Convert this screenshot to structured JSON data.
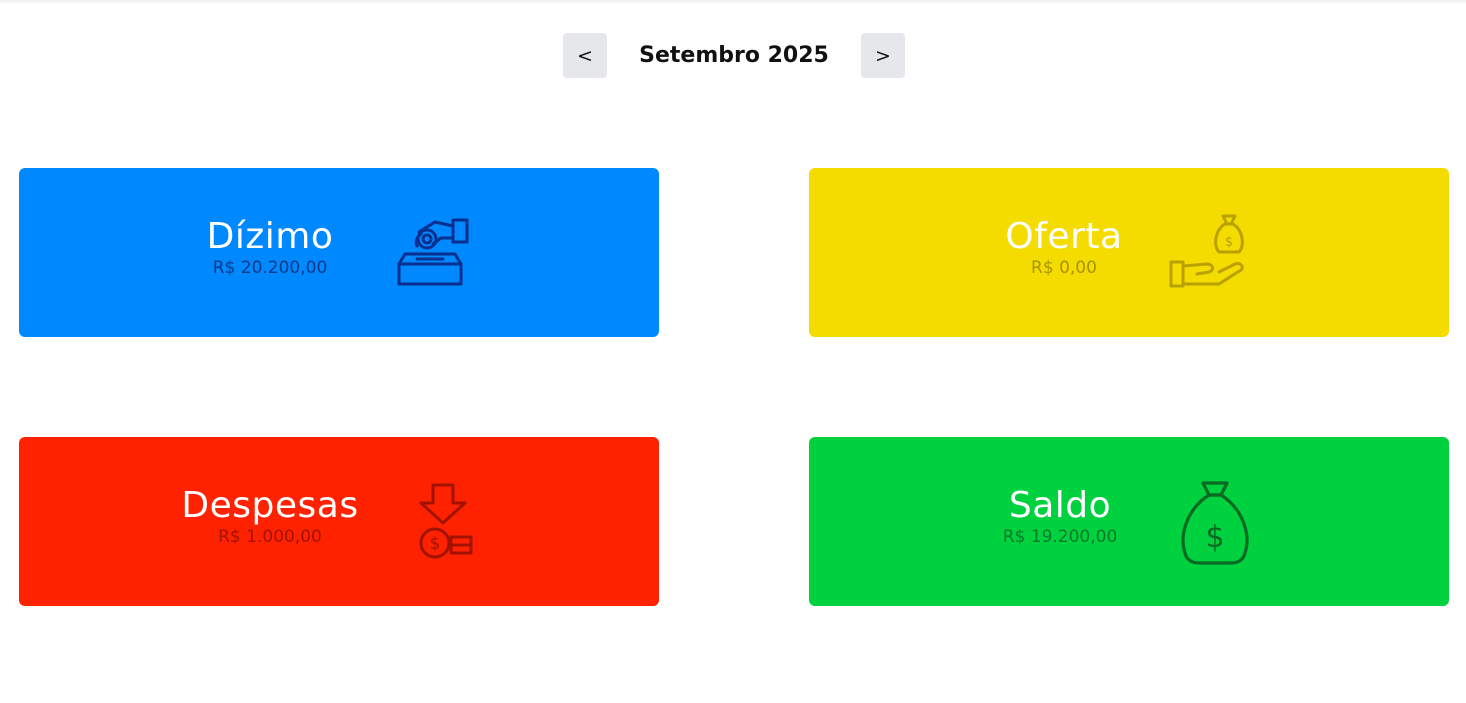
{
  "month_nav": {
    "prev_label": "<",
    "month_label": "Setembro 2025",
    "next_label": ">"
  },
  "cards": [
    {
      "title": "Dízimo",
      "value": "R$ 20.200,00",
      "icon": "hand-coin-box-icon",
      "background": "#0088ff",
      "value_color": "#0a3a86",
      "icon_color": "#0b2f8f"
    },
    {
      "title": "Oferta",
      "value": "R$ 0,00",
      "icon": "hand-money-bag-icon",
      "background": "#f4dc00",
      "value_color": "#a89400",
      "icon_color": "#b9a100"
    },
    {
      "title": "Despesas",
      "value": "R$ 1.000,00",
      "icon": "arrow-down-coins-icon",
      "background": "#ff2200",
      "value_color": "#a31200",
      "icon_color": "#a31200"
    },
    {
      "title": "Saldo",
      "value": "R$ 19.200,00",
      "icon": "money-bag-icon",
      "background": "#00d13f",
      "value_color": "#0a7a28",
      "icon_color": "#0a6a22"
    }
  ]
}
